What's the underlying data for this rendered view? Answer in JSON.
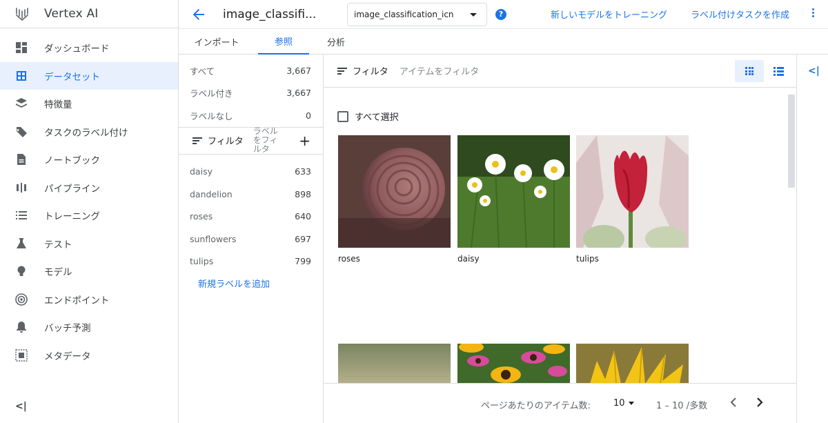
{
  "app": {
    "title": "Vertex AI"
  },
  "nav": {
    "items": [
      {
        "label": "ダッシュボード",
        "icon": "dashboard-icon"
      },
      {
        "label": "データセット",
        "icon": "dataset-icon",
        "active": true
      },
      {
        "label": "特徴量",
        "icon": "feature-store-icon"
      },
      {
        "label": "タスクのラベル付け",
        "icon": "label-tag-icon"
      },
      {
        "label": "ノートブック",
        "icon": "notebook-icon"
      },
      {
        "label": "パイプライン",
        "icon": "pipeline-icon"
      },
      {
        "label": "トレーニング",
        "icon": "training-list-icon"
      },
      {
        "label": "テスト",
        "icon": "flask-icon"
      },
      {
        "label": "モデル",
        "icon": "lightbulb-icon"
      },
      {
        "label": "エンドポイント",
        "icon": "endpoint-target-icon"
      },
      {
        "label": "バッチ予測",
        "icon": "bell-icon"
      },
      {
        "label": "メタデータ",
        "icon": "metadata-icon"
      }
    ],
    "collapse_label": "<|"
  },
  "header": {
    "dataset_title": "image_classifi...",
    "select_value": "image_classification_icn",
    "help_label": "?",
    "train_link": "新しいモデルをトレーニング",
    "label_task_link": "ラベル付けタスクを作成"
  },
  "tabs": [
    "インポート",
    "参照",
    "分析"
  ],
  "summary": [
    {
      "label": "すべて",
      "count": "3,667"
    },
    {
      "label": "ラベル付き",
      "count": "3,667"
    },
    {
      "label": "ラベルなし",
      "count": "0"
    }
  ],
  "label_filter": {
    "label": "フィルタ",
    "placeholder": "ラベルをフィルタ",
    "add": "+"
  },
  "labels": [
    {
      "label": "daisy",
      "count": "633"
    },
    {
      "label": "dandelion",
      "count": "898"
    },
    {
      "label": "roses",
      "count": "640"
    },
    {
      "label": "sunflowers",
      "count": "697"
    },
    {
      "label": "tulips",
      "count": "799"
    }
  ],
  "add_label": "新規ラベルを追加",
  "main": {
    "filter_label": "フィルタ",
    "filter_placeholder": "アイテムをフィルタ",
    "select_all": "すべて選択",
    "images": [
      {
        "caption": "roses",
        "color": "#8e5a5c"
      },
      {
        "caption": "daisy",
        "color": "#4e7a2e"
      },
      {
        "caption": "tulips",
        "color": "#c4213a"
      },
      {
        "caption": "",
        "color": "#9aa07a"
      },
      {
        "caption": "",
        "color": "#d9a21f"
      },
      {
        "caption": "",
        "color": "#e2b512"
      }
    ]
  },
  "footer": {
    "per_page_label": "ページあたりのアイテム数:",
    "per_page_value": "10",
    "range": "1 – 10 /多数"
  },
  "colors": {
    "accent": "#1a73e8",
    "active_bg": "#e8f0fe",
    "divider": "#dadce0"
  }
}
